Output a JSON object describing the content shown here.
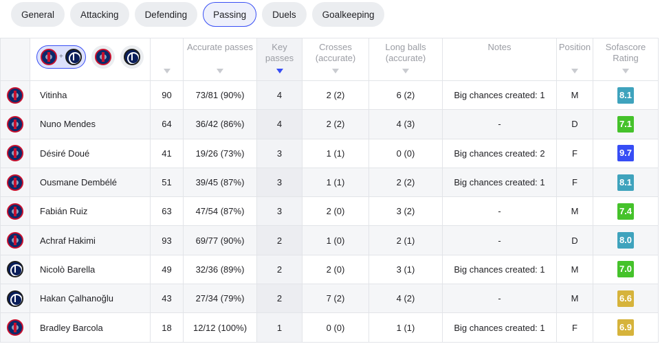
{
  "tabs": [
    {
      "label": "General",
      "active": false
    },
    {
      "label": "Attacking",
      "active": false
    },
    {
      "label": "Defending",
      "active": false
    },
    {
      "label": "Passing",
      "active": true
    },
    {
      "label": "Duels",
      "active": false
    },
    {
      "label": "Goalkeeping",
      "active": false
    }
  ],
  "header": {
    "plus": "+",
    "columns": {
      "accurate_passes": "Accurate passes",
      "key_passes_1": "Key",
      "key_passes_2": "passes",
      "crosses_1": "Crosses",
      "crosses_2": "(accurate)",
      "long_balls_1": "Long balls",
      "long_balls_2": "(accurate)",
      "notes": "Notes",
      "position": "Position",
      "rating_1": "Sofascore",
      "rating_2": "Rating"
    }
  },
  "colors": {
    "accent": "#374df5",
    "rating_blue": "#3fa3bd",
    "rating_green": "#45c22b",
    "rating_darkblue": "#374df5",
    "rating_gold": "#d6b33b"
  },
  "players": [
    {
      "team": "psg",
      "name": "Vitinha",
      "minutes": "90",
      "accurate_passes": "73/81 (90%)",
      "key_passes": "4",
      "crosses": "2 (2)",
      "long_balls": "6 (2)",
      "notes": "Big chances created: 1",
      "position": "M",
      "rating": "8.1",
      "rating_color": "#3fa3bd"
    },
    {
      "team": "psg",
      "name": "Nuno Mendes",
      "minutes": "64",
      "accurate_passes": "36/42 (86%)",
      "key_passes": "4",
      "crosses": "2 (2)",
      "long_balls": "4 (3)",
      "notes": "-",
      "position": "D",
      "rating": "7.1",
      "rating_color": "#45c22b"
    },
    {
      "team": "psg",
      "name": "Désiré Doué",
      "minutes": "41",
      "accurate_passes": "19/26 (73%)",
      "key_passes": "3",
      "crosses": "1 (1)",
      "long_balls": "0 (0)",
      "notes": "Big chances created: 2",
      "position": "F",
      "rating": "9.7",
      "rating_color": "#374df5"
    },
    {
      "team": "psg",
      "name": "Ousmane Dembélé",
      "minutes": "51",
      "accurate_passes": "39/45 (87%)",
      "key_passes": "3",
      "crosses": "1 (1)",
      "long_balls": "2 (2)",
      "notes": "Big chances created: 1",
      "position": "F",
      "rating": "8.1",
      "rating_color": "#3fa3bd"
    },
    {
      "team": "psg",
      "name": "Fabián Ruiz",
      "minutes": "63",
      "accurate_passes": "47/54 (87%)",
      "key_passes": "3",
      "crosses": "2 (0)",
      "long_balls": "3 (2)",
      "notes": "-",
      "position": "M",
      "rating": "7.4",
      "rating_color": "#45c22b"
    },
    {
      "team": "psg",
      "name": "Achraf Hakimi",
      "minutes": "93",
      "accurate_passes": "69/77 (90%)",
      "key_passes": "2",
      "crosses": "1 (0)",
      "long_balls": "2 (1)",
      "notes": "-",
      "position": "D",
      "rating": "8.0",
      "rating_color": "#3fa3bd"
    },
    {
      "team": "inter",
      "name": "Nicolò Barella",
      "minutes": "49",
      "accurate_passes": "32/36 (89%)",
      "key_passes": "2",
      "crosses": "2 (0)",
      "long_balls": "3 (1)",
      "notes": "Big chances created: 1",
      "position": "M",
      "rating": "7.0",
      "rating_color": "#45c22b"
    },
    {
      "team": "inter",
      "name": "Hakan Çalhanoğlu",
      "minutes": "43",
      "accurate_passes": "27/34 (79%)",
      "key_passes": "2",
      "crosses": "7 (2)",
      "long_balls": "4 (2)",
      "notes": "-",
      "position": "M",
      "rating": "6.6",
      "rating_color": "#d6b33b"
    },
    {
      "team": "psg",
      "name": "Bradley Barcola",
      "minutes": "18",
      "accurate_passes": "12/12 (100%)",
      "key_passes": "1",
      "crosses": "0 (0)",
      "long_balls": "1 (1)",
      "notes": "Big chances created: 1",
      "position": "F",
      "rating": "6.9",
      "rating_color": "#d6b33b"
    }
  ]
}
